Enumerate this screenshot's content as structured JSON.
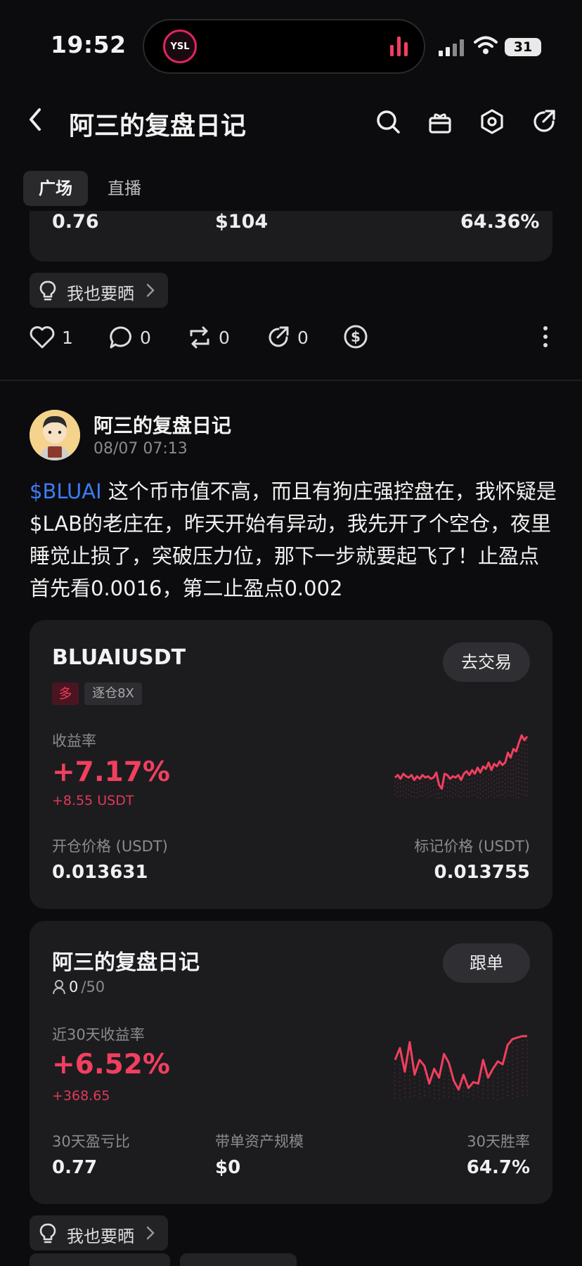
{
  "status_bar": {
    "time": "19:52",
    "battery": "31"
  },
  "nav": {
    "title": "阿三的复盘日记"
  },
  "tabs": [
    {
      "label": "广场"
    },
    {
      "label": "直播"
    }
  ],
  "prev_card": {
    "v1": "0.76",
    "v2": "$104",
    "v3": "64.36%"
  },
  "share_pill": {
    "label": "我也要晒"
  },
  "actions": {
    "like": "1",
    "comment": "0",
    "repost": "0",
    "share": "0"
  },
  "post": {
    "author": "阿三的复盘日记",
    "time": "08/07 07:13",
    "tag": "$BLUAI",
    "text": " 这个币市值不高，而且有狗庄强控盘在，我怀疑是$LAB的老庄在，昨天开始有异动，我先开了个空仓，夜里睡觉止损了，突破压力位，那下一步就要起飞了！止盈点首先看0.0016，第二止盈点0.002"
  },
  "trade_card": {
    "symbol": "BLUAIUSDT",
    "button": "去交易",
    "side": "多",
    "leverage": "逐仓8X",
    "roi_label": "收益率",
    "roi": "+7.17%",
    "pnl": "+8.55 USDT",
    "open_label": "开仓价格 (USDT)",
    "open_price": "0.013631",
    "mark_label": "标记价格 (USDT)",
    "mark_price": "0.013755",
    "chart_points": [
      10,
      12,
      9,
      13,
      11,
      10,
      12,
      8,
      11,
      9,
      12,
      10,
      11,
      9,
      10,
      14,
      4,
      1,
      13,
      12,
      9,
      11,
      10,
      12,
      8,
      13,
      15,
      12,
      16,
      13,
      18,
      14,
      19,
      17,
      22,
      16,
      21,
      19,
      23,
      20,
      22,
      30,
      26,
      33,
      31,
      38,
      44,
      40,
      43
    ]
  },
  "copy_card": {
    "name": "阿三的复盘日记",
    "followers": "0",
    "followers_max": "/50",
    "roi_label": "近30天收益率",
    "roi": "+6.52%",
    "pnl": "+368.65",
    "b1_label": "30天盈亏比",
    "b1": "0.77",
    "b2_label": "带单资产规模",
    "b2": "$0",
    "b3_label": "30天胜率",
    "b3": "64.7%",
    "button": "跟单",
    "chart_points": [
      30,
      38,
      22,
      42,
      20,
      30,
      26,
      14,
      24,
      18,
      34,
      28,
      16,
      10,
      20,
      11,
      15,
      14,
      30,
      18,
      24,
      29,
      27,
      40,
      44,
      45,
      46,
      46
    ]
  },
  "colors": {
    "accent_red": "#f23f5f",
    "link_blue": "#3d7cf5",
    "bg": "#0c0c0e",
    "card": "#1c1c1f"
  }
}
